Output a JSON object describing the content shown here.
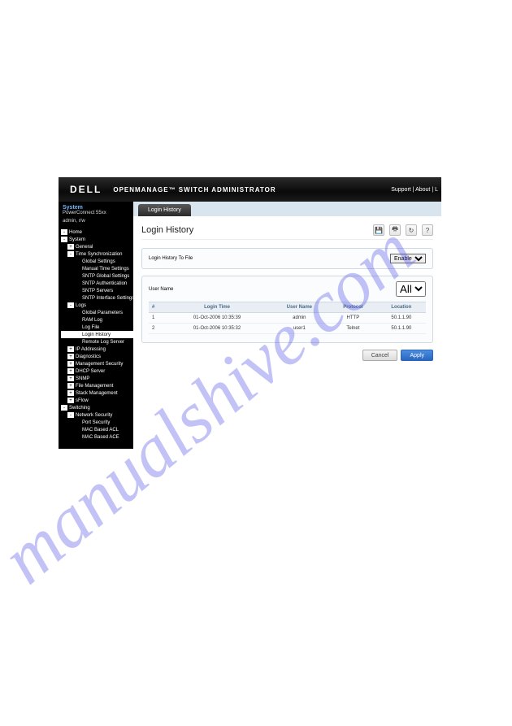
{
  "header": {
    "logo": "DELL",
    "product": "OPENMANAGE™ SWITCH ADMINISTRATOR",
    "links": {
      "support": "Support",
      "about": "About",
      "sep": " | "
    }
  },
  "sidebar": {
    "sys_label": "System",
    "sys_model": "PowerConnect 55xx",
    "sys_user": "admin, r/w",
    "tree": [
      {
        "depth": 0,
        "tgl": "-",
        "label": "Home"
      },
      {
        "depth": 0,
        "tgl": "-",
        "label": "System"
      },
      {
        "depth": 1,
        "tgl": "+",
        "label": "General"
      },
      {
        "depth": 1,
        "tgl": "-",
        "label": "Time Synchronization"
      },
      {
        "depth": 2,
        "tgl": "",
        "label": "Global Settings"
      },
      {
        "depth": 2,
        "tgl": "",
        "label": "Manual Time Settings"
      },
      {
        "depth": 2,
        "tgl": "",
        "label": "SNTP Global Settings"
      },
      {
        "depth": 2,
        "tgl": "",
        "label": "SNTP Authentication"
      },
      {
        "depth": 2,
        "tgl": "",
        "label": "SNTP Servers"
      },
      {
        "depth": 2,
        "tgl": "",
        "label": "SNTP Interface Settings"
      },
      {
        "depth": 1,
        "tgl": "-",
        "label": "Logs"
      },
      {
        "depth": 2,
        "tgl": "",
        "label": "Global Parameters"
      },
      {
        "depth": 2,
        "tgl": "",
        "label": "RAM Log"
      },
      {
        "depth": 2,
        "tgl": "",
        "label": "Log File"
      },
      {
        "depth": 2,
        "tgl": "",
        "label": "Login History",
        "selected": true
      },
      {
        "depth": 2,
        "tgl": "",
        "label": "Remote Log Server"
      },
      {
        "depth": 1,
        "tgl": "+",
        "label": "IP Addressing"
      },
      {
        "depth": 1,
        "tgl": "+",
        "label": "Diagnostics"
      },
      {
        "depth": 1,
        "tgl": "+",
        "label": "Management Security"
      },
      {
        "depth": 1,
        "tgl": "+",
        "label": "DHCP Server"
      },
      {
        "depth": 1,
        "tgl": "+",
        "label": "SNMP"
      },
      {
        "depth": 1,
        "tgl": "+",
        "label": "File Management"
      },
      {
        "depth": 1,
        "tgl": "+",
        "label": "Stack Management"
      },
      {
        "depth": 1,
        "tgl": "+",
        "label": "sFlow"
      },
      {
        "depth": 0,
        "tgl": "-",
        "label": "Switching"
      },
      {
        "depth": 1,
        "tgl": "-",
        "label": "Network Security"
      },
      {
        "depth": 2,
        "tgl": "",
        "label": "Port Security"
      },
      {
        "depth": 2,
        "tgl": "",
        "label": "MAC Based ACL"
      },
      {
        "depth": 2,
        "tgl": "",
        "label": "MAC Based ACE"
      }
    ]
  },
  "tab": {
    "label": "Login History"
  },
  "page": {
    "title": "Login History",
    "toolbar": {
      "save": "💾",
      "print": "🖶",
      "refresh": "↻",
      "help": "?"
    },
    "history_to_file_label": "Login History To File",
    "history_to_file_value": "Enable",
    "user_name_label": "User Name",
    "user_name_value": "All",
    "columns": {
      "idx": "#",
      "login_time": "Login Time",
      "user_name": "User Name",
      "protocol": "Protocol",
      "location": "Location"
    },
    "rows": [
      {
        "idx": "1",
        "login_time": "01-Oct-2006 10:35:39",
        "user_name": "admin",
        "protocol": "HTTP",
        "location": "50.1.1.90"
      },
      {
        "idx": "2",
        "login_time": "01-Oct-2006 10:35:32",
        "user_name": "user1",
        "protocol": "Telnet",
        "location": "50.1.1.90"
      }
    ],
    "cancel": "Cancel",
    "apply": "Apply"
  },
  "watermark": "manualshive.com"
}
